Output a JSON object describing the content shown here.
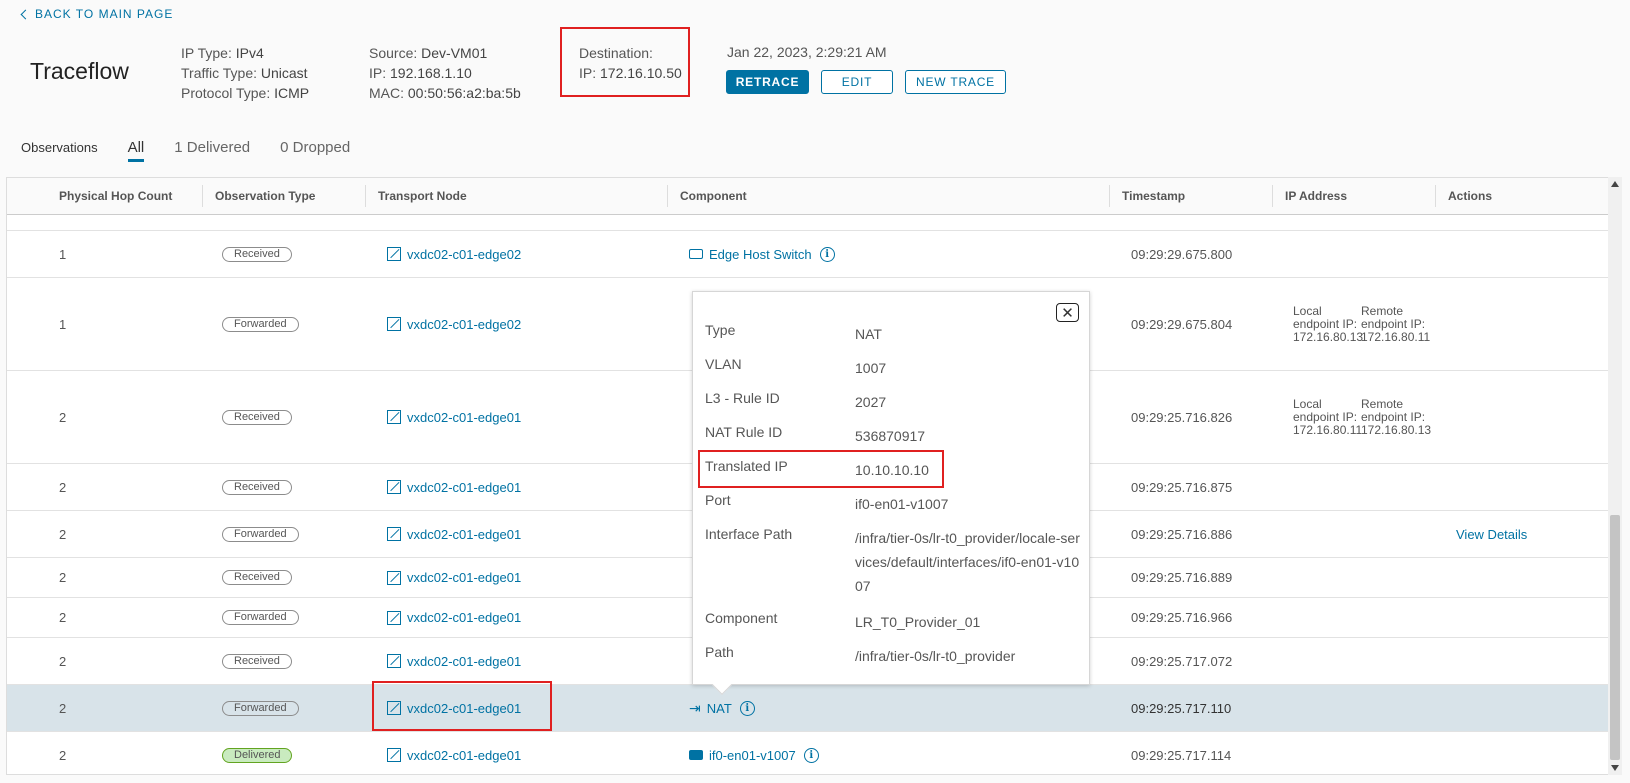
{
  "header": {
    "back_label": "BACK TO MAIN PAGE",
    "title": "Traceflow",
    "ip_type_label": "IP Type:",
    "ip_type": "IPv4",
    "traffic_type_label": "Traffic Type:",
    "traffic_type": "Unicast",
    "protocol_type_label": "Protocol Type:",
    "protocol_type": "ICMP",
    "source_label": "Source:",
    "source": "Dev-VM01",
    "src_ip_label": "IP:",
    "src_ip": "192.168.1.10",
    "mac_label": "MAC:",
    "mac": "00:50:56:a2:ba:5b",
    "destination_label": "Destination:",
    "dst_ip_label": "IP:",
    "dst_ip": "172.16.10.50",
    "timestamp": "Jan 22, 2023, 2:29:21 AM",
    "retrace_label": "RETRACE",
    "edit_label": "EDIT",
    "new_trace_label": "NEW TRACE"
  },
  "tabs": {
    "title": "Observations",
    "items": [
      "All",
      "1 Delivered",
      "0 Dropped"
    ],
    "active": "All"
  },
  "table": {
    "columns": [
      "Physical Hop Count",
      "Observation Type",
      "Transport Node",
      "Component",
      "Timestamp",
      "IP Address",
      "Actions"
    ],
    "rows": [
      {
        "hop": "1",
        "type": "Received",
        "node": "vxdc02-c01-edge02",
        "component": "Edge Host Switch",
        "timestamp": "09:29:29.675.800",
        "ip_local": "",
        "ip_remote": "",
        "action": ""
      },
      {
        "hop": "1",
        "type": "Forwarded",
        "node": "vxdc02-c01-edge02",
        "component": "",
        "timestamp": "09:29:29.675.804",
        "ip_local": "Local endpoint IP: 172.16.80.13",
        "ip_remote": "Remote endpoint IP: 172.16.80.11",
        "action": ""
      },
      {
        "hop": "2",
        "type": "Received",
        "node": "vxdc02-c01-edge01",
        "component": "",
        "timestamp": "09:29:25.716.826",
        "ip_local": "Local endpoint IP: 172.16.80.11",
        "ip_remote": "Remote endpoint IP: 172.16.80.13",
        "action": ""
      },
      {
        "hop": "2",
        "type": "Received",
        "node": "vxdc02-c01-edge01",
        "component": "",
        "timestamp": "09:29:25.716.875",
        "ip_local": "",
        "ip_remote": "",
        "action": ""
      },
      {
        "hop": "2",
        "type": "Forwarded",
        "node": "vxdc02-c01-edge01",
        "component": "",
        "timestamp": "09:29:25.716.886",
        "ip_local": "",
        "ip_remote": "",
        "action": "View Details"
      },
      {
        "hop": "2",
        "type": "Received",
        "node": "vxdc02-c01-edge01",
        "component": "",
        "timestamp": "09:29:25.716.889",
        "ip_local": "",
        "ip_remote": "",
        "action": ""
      },
      {
        "hop": "2",
        "type": "Forwarded",
        "node": "vxdc02-c01-edge01",
        "component": "",
        "timestamp": "09:29:25.716.966",
        "ip_local": "",
        "ip_remote": "",
        "action": ""
      },
      {
        "hop": "2",
        "type": "Received",
        "node": "vxdc02-c01-edge01",
        "component": "",
        "timestamp": "09:29:25.717.072",
        "ip_local": "",
        "ip_remote": "",
        "action": ""
      },
      {
        "hop": "2",
        "type": "Forwarded",
        "node": "vxdc02-c01-edge01",
        "component": "NAT",
        "timestamp": "09:29:25.717.110",
        "ip_local": "",
        "ip_remote": "",
        "action": ""
      },
      {
        "hop": "2",
        "type": "Delivered",
        "node": "vxdc02-c01-edge01",
        "component": "if0-en01-v1007",
        "timestamp": "09:29:25.717.114",
        "ip_local": "",
        "ip_remote": "",
        "action": ""
      }
    ]
  },
  "popover": {
    "items": [
      {
        "key": "Type",
        "value": "NAT"
      },
      {
        "key": "VLAN",
        "value": "1007"
      },
      {
        "key": "L3 - Rule ID",
        "value": "2027"
      },
      {
        "key": "NAT Rule ID",
        "value": "536870917"
      },
      {
        "key": "Translated IP",
        "value": "10.10.10.10"
      },
      {
        "key": "Port",
        "value": "if0-en01-v1007"
      },
      {
        "key": "Interface Path",
        "value": "/infra/tier-0s/lr-t0_provider/locale-services/default/interfaces/if0-en01-v1007"
      },
      {
        "key": "Component",
        "value": "LR_T0_Provider_01"
      },
      {
        "key": "Path",
        "value": "/infra/tier-0s/lr-t0_provider"
      }
    ]
  },
  "colors": {
    "accent": "#0072a3",
    "highlight": "#e02020",
    "selected_row": "#d8e3e9",
    "delivered_badge": "#c9ebbf"
  }
}
